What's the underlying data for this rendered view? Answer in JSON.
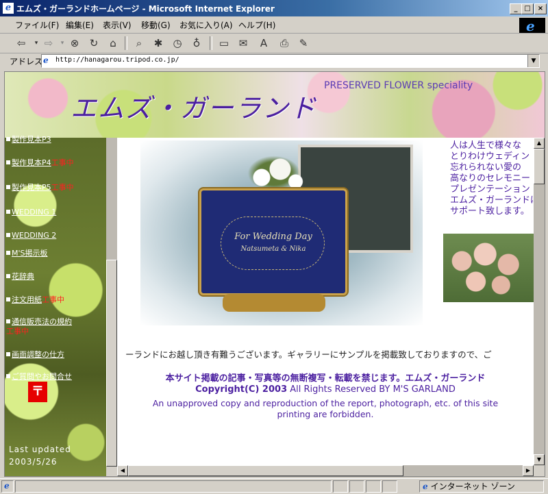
{
  "window": {
    "title": "エムズ・ガーランドホームページ - Microsoft Internet Explorer",
    "buttons": {
      "minimize": "_",
      "maximize": "□",
      "close": "×"
    }
  },
  "menu": [
    "ファイル(F)",
    "編集(E)",
    "表示(V)",
    "移動(G)",
    "お気に入り(A)",
    "ヘルプ(H)"
  ],
  "address": {
    "label": "アドレス",
    "url": "http://hanagarou.tripod.co.jp/"
  },
  "banner": {
    "logo": "エムズ・ガーランド",
    "speciality": "PRESERVED FLOWER speciality"
  },
  "side_nav": [
    {
      "label": "製作見本P3",
      "suffix": ""
    },
    {
      "label": "製作見本P4",
      "suffix": "工事中"
    },
    {
      "label": "製作見本P5",
      "suffix": "工事中"
    },
    {
      "label": "WEDDING 1",
      "suffix": ""
    },
    {
      "label": "WEDDING 2",
      "suffix": ""
    },
    {
      "label": "M'S掲示板",
      "suffix": ""
    },
    {
      "label": "花辞典",
      "suffix": ""
    },
    {
      "label": "注文用紙",
      "suffix": "工事中"
    },
    {
      "label": "通信販売法の規約",
      "suffix": "工事中"
    },
    {
      "label": "画面調整の仕方",
      "suffix": ""
    },
    {
      "label": "ご質問やお問合せ",
      "suffix": ""
    }
  ],
  "postbox_symbol": "〒",
  "last_updated": {
    "label": "Last updated",
    "date": "2003/5/26"
  },
  "photo": {
    "board_line1": "For Wedding Day",
    "board_line2": "Natsumeta & Nika"
  },
  "intro_lines": [
    "人は人生で様々な",
    "とりわけウェディン",
    "忘れられない愛の",
    "高なりのセレモニー",
    "プレゼンテーション",
    "エムズ・ガーランドは",
    "サポート致します。"
  ],
  "welcome": "ーランドにお越し頂き有難うございます。ギャラリーにサンプルを掲載致しておりますので、ご",
  "notice": "本サイト掲載の記事・写真等の無断複写・転載を禁じます。エムズ・ガーランド",
  "copyright": {
    "bold": "Copyright(C) 2003",
    "rest": " All Rights Reserved  BY  M'S  GARLAND"
  },
  "english_notice": [
    "An unapproved copy and reproduction of the report, photograph, etc. of this site",
    "printing are forbidden."
  ],
  "status": {
    "zone": "インターネット ゾーン"
  }
}
